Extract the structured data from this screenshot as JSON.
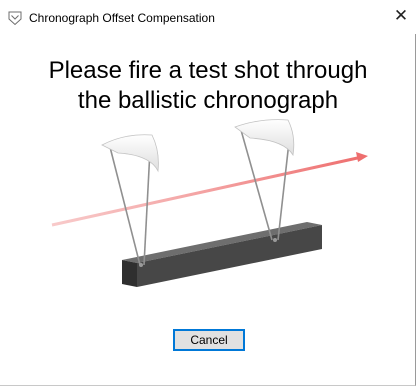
{
  "window": {
    "title": "Chronograph Offset Compensation",
    "close_symbol": "✕"
  },
  "prompt": {
    "line1": "Please fire a test shot through",
    "line2": "the ballistic chronograph"
  },
  "illustration": {
    "icon": "ballistic-chronograph",
    "colors": {
      "shot_line": "#f28a8a",
      "base": "#4a4a4a",
      "skyscreen": "#eeeeee"
    }
  },
  "buttons": {
    "cancel_label": "Cancel"
  }
}
